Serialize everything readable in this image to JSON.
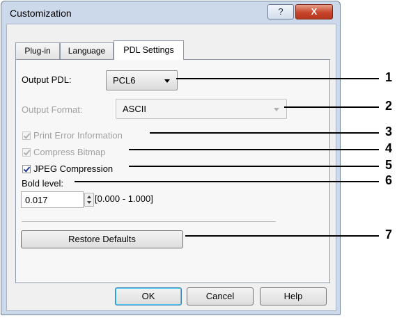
{
  "window": {
    "title": "Customization",
    "help_btn": "?",
    "close_btn": "X"
  },
  "tabs": [
    {
      "label": "Plug-in"
    },
    {
      "label": "Language"
    },
    {
      "label": "PDL Settings",
      "active": true
    }
  ],
  "output_pdl": {
    "label": "Output PDL:",
    "value": "PCL6"
  },
  "output_format": {
    "label": "Output Format:",
    "value": "ASCII",
    "enabled": false
  },
  "checkboxes": [
    {
      "label": "Print Error Information",
      "checked": true,
      "enabled": false
    },
    {
      "label": "Compress Bitmap",
      "checked": true,
      "enabled": false
    },
    {
      "label": "JPEG Compression",
      "checked": true,
      "enabled": true
    }
  ],
  "bold_level": {
    "label": "Bold level:",
    "value": "0.017",
    "range": "[0.000 - 1.000]"
  },
  "restore_defaults": "Restore Defaults",
  "buttons": {
    "ok": "OK",
    "cancel": "Cancel",
    "help": "Help"
  },
  "callouts": [
    "1",
    "2",
    "3",
    "4",
    "5",
    "6",
    "7"
  ]
}
